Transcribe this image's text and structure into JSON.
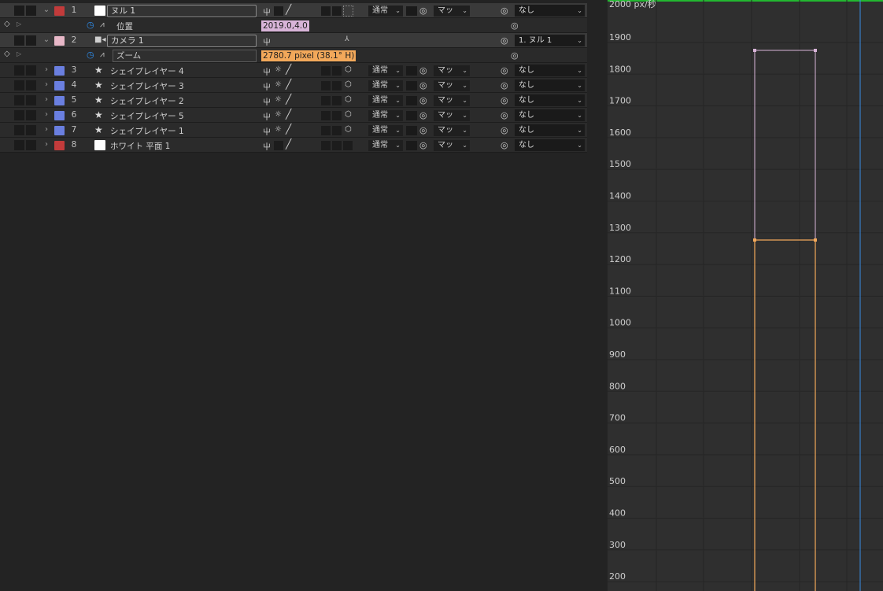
{
  "layers_panel": {
    "rows": [
      {
        "kind": "layer",
        "num": "1",
        "name": "ヌル 1",
        "label_color": "#c23b3b",
        "src": "white-box",
        "mode": "通常",
        "matte": "マッ",
        "parent": "なし",
        "expanded": true,
        "name_editable": true
      },
      {
        "kind": "prop",
        "name": "位置",
        "value": "2019.0,4.0",
        "value_color": "#d8b4d8"
      },
      {
        "kind": "layer",
        "num": "2",
        "name": "カメラ 1",
        "label_color": "#e8b8c8",
        "src": "camera",
        "parent": "1. ヌル 1",
        "expanded": true,
        "name_editable": true
      },
      {
        "kind": "prop",
        "name": "ズーム",
        "value": "2780.7 pixel (38.1° H)",
        "value_color": "#f2a85a"
      },
      {
        "kind": "layer",
        "num": "3",
        "name": "シェイプレイヤー 4",
        "label_color": "#6a7fe0",
        "src": "star",
        "mode": "通常",
        "matte": "マッ",
        "parent": "なし"
      },
      {
        "kind": "layer",
        "num": "4",
        "name": "シェイプレイヤー 3",
        "label_color": "#6a7fe0",
        "src": "star",
        "mode": "通常",
        "matte": "マッ",
        "parent": "なし"
      },
      {
        "kind": "layer",
        "num": "5",
        "name": "シェイプレイヤー 2",
        "label_color": "#6a7fe0",
        "src": "star",
        "mode": "通常",
        "matte": "マッ",
        "parent": "なし"
      },
      {
        "kind": "layer",
        "num": "6",
        "name": "シェイプレイヤー 5",
        "label_color": "#6a7fe0",
        "src": "star",
        "mode": "通常",
        "matte": "マッ",
        "parent": "なし"
      },
      {
        "kind": "layer",
        "num": "7",
        "name": "シェイプレイヤー 1",
        "label_color": "#6a7fe0",
        "src": "star",
        "mode": "通常",
        "matte": "マッ",
        "parent": "なし"
      },
      {
        "kind": "layer",
        "num": "8",
        "name": "ホワイト 平面 1",
        "label_color": "#c23b3b",
        "src": "white-box",
        "mode": "通常",
        "matte": "マッ",
        "parent": "なし"
      }
    ]
  },
  "graph_editor": {
    "unit_label": "2000 px/秒",
    "y_ticks": [
      "1900",
      "1800",
      "1700",
      "1600",
      "1500",
      "1400",
      "1300",
      "1200",
      "1100",
      "1000",
      "900",
      "800",
      "700",
      "600",
      "500",
      "400",
      "300",
      "200"
    ],
    "curve_colors": {
      "position": "#d8b4d8",
      "zoom": "#f2a85a"
    },
    "top_bar_color": "#22b830",
    "playhead_color": "#3a8ee6"
  },
  "icons": {
    "twirl_open": "chevron-down-icon",
    "twirl_closed": "chevron-right-icon",
    "stopwatch": "stopwatch-icon",
    "graph": "graph-icon",
    "keyframe": "keyframe-diamond-icon",
    "pickwhip": "spiral-pickwhip-icon",
    "shy": "shy-icon",
    "collapse": "sun-collapse-icon",
    "quality": "quality-slash-icon",
    "3d": "cube-3d-icon",
    "camera": "camera-icon",
    "shape": "star-icon"
  }
}
